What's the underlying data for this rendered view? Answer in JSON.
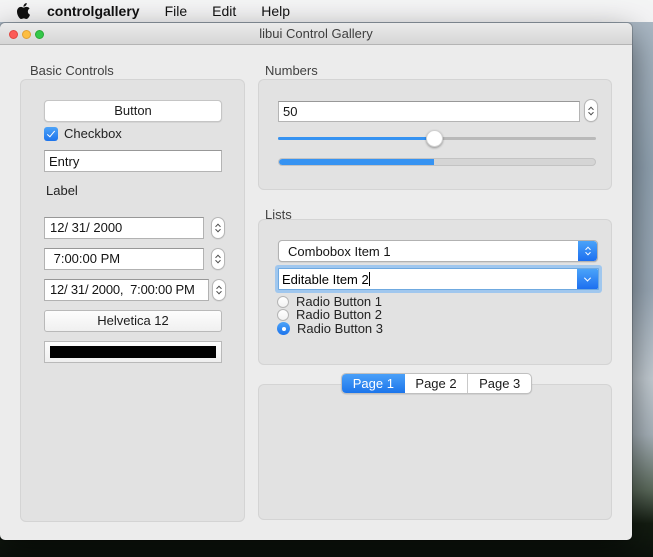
{
  "menubar": {
    "app_name": "controlgallery",
    "items": [
      "File",
      "Edit",
      "Help"
    ]
  },
  "window": {
    "title": "libui Control Gallery"
  },
  "basic_controls": {
    "section_label": "Basic Controls",
    "button_label": "Button",
    "checkbox_label": "Checkbox",
    "checkbox_checked": true,
    "entry_value": "Entry",
    "label_text": "Label",
    "date_value": "12/ 31/ 2000",
    "time_value": " 7:00:00 PM",
    "datetime_value": "12/ 31/ 2000,  7:00:00 PM",
    "font_button_label": "Helvetica 12",
    "color_well_value": "#000000"
  },
  "numbers": {
    "section_label": "Numbers",
    "spinbox_value": "50",
    "slider_percent": 49,
    "progress_percent": 49
  },
  "lists": {
    "section_label": "Lists",
    "combobox_value": "Combobox Item 1",
    "editable_combobox_value": "Editable Item 2",
    "radio_buttons": [
      {
        "label": "Radio Button 1",
        "selected": false
      },
      {
        "label": "Radio Button 2",
        "selected": false
      },
      {
        "label": "Radio Button 3",
        "selected": true
      }
    ]
  },
  "tabs": {
    "items": [
      {
        "label": "Page 1",
        "selected": true
      },
      {
        "label": "Page 2",
        "selected": false
      },
      {
        "label": "Page 3",
        "selected": false
      }
    ]
  },
  "colors": {
    "accent_blue": "#2f86f1",
    "accent_blue_light": "#4aa3f9",
    "slider_blue": "#3693f2",
    "color_well": "#000000"
  }
}
